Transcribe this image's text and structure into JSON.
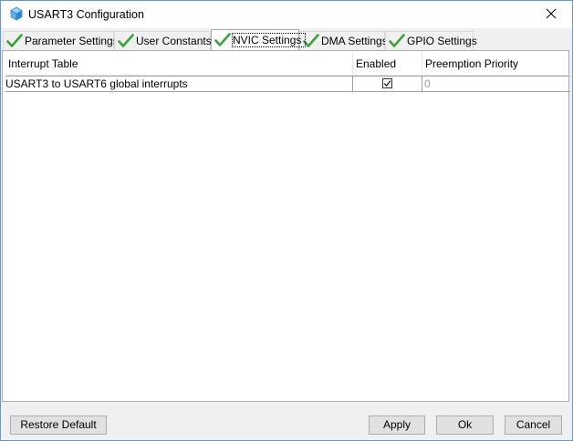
{
  "window": {
    "title": "USART3 Configuration",
    "icon": "cube-app-icon",
    "close_icon": "close-icon"
  },
  "tabs": [
    {
      "label": "Parameter Settings",
      "status_icon": "green-check-icon",
      "selected": false
    },
    {
      "label": "User Constants",
      "status_icon": "green-check-icon",
      "selected": false
    },
    {
      "label": "NVIC Settings",
      "status_icon": "green-check-icon",
      "selected": true
    },
    {
      "label": "DMA Settings",
      "status_icon": "green-check-icon",
      "selected": false
    },
    {
      "label": "GPIO Settings",
      "status_icon": "green-check-icon",
      "selected": false
    }
  ],
  "table": {
    "columns": [
      "Interrupt Table",
      "Enabled",
      "Preemption Priority"
    ],
    "rows": [
      {
        "interrupt": "USART3 to USART6 global interrupts",
        "enabled": true,
        "preemption_priority": "0"
      }
    ]
  },
  "buttons": {
    "restore_default": "Restore Default",
    "apply": "Apply",
    "ok": "Ok",
    "cancel": "Cancel"
  },
  "colors": {
    "check_green": "#3aa33a",
    "title_bar": "#ffffff",
    "window_border": "#5c9bd1",
    "dialog_bg": "#f0f0f0",
    "disabled_text": "#a0a0a0"
  }
}
